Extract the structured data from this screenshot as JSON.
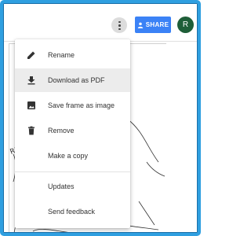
{
  "header": {
    "more_icon": "more-vert-icon",
    "share_label": "SHARE",
    "share_icon": "person-icon",
    "avatar_initial": "R",
    "share_color": "#3b82f6",
    "avatar_color": "#1e5e38"
  },
  "menu": {
    "items": [
      {
        "label": "Rename",
        "icon": "pencil-icon"
      },
      {
        "label": "Download as PDF",
        "icon": "download-icon",
        "highlighted": true
      },
      {
        "label": "Save frame as image",
        "icon": "image-icon"
      },
      {
        "label": "Remove",
        "icon": "trash-icon"
      },
      {
        "label": "Make a copy",
        "icon": ""
      },
      {
        "label": "Updates",
        "icon": ""
      },
      {
        "label": "Send feedback",
        "icon": ""
      }
    ]
  },
  "canvas": {
    "sketch_text": "RR"
  },
  "colors": {
    "frame_border": "#2f9fe0",
    "menu_highlight": "#ececec"
  }
}
